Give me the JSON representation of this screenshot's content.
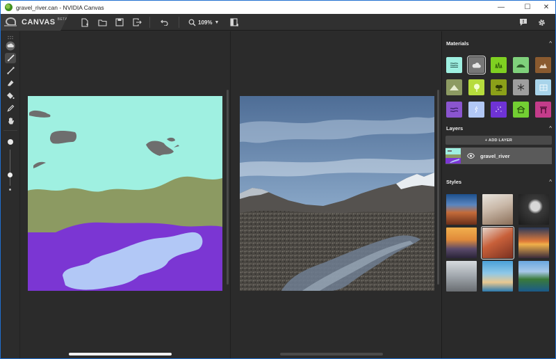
{
  "window": {
    "title": "gravel_river.can - NVIDIA Canvas",
    "minimize": "—",
    "maximize": "☐",
    "close": "✕"
  },
  "toolbar": {
    "brand": "CANVAS",
    "beta": "BETA",
    "zoom": "109%",
    "zoom_caret": "▼"
  },
  "panel": {
    "materials_label": "Materials",
    "layers_label": "Layers",
    "styles_label": "Styles",
    "add_layer_label": "+ ADD LAYER",
    "layer_name": "gravel_river",
    "collapse_glyph": "^"
  },
  "materials": [
    {
      "name": "sky-water-icon",
      "color": "#9ff0e1"
    },
    {
      "name": "cloud-icon",
      "color": "#777777"
    },
    {
      "name": "grass-icon",
      "color": "#7fd021"
    },
    {
      "name": "hill-icon",
      "color": "#7fd07b"
    },
    {
      "name": "rock-icon",
      "color": "#8a5a2f"
    },
    {
      "name": "mountain-icon",
      "color": "#8c9a62"
    },
    {
      "name": "tree-icon",
      "color": "#b6dc3d"
    },
    {
      "name": "bush-icon",
      "color": "#8ba019"
    },
    {
      "name": "snow-icon",
      "color": "#9e9e9e"
    },
    {
      "name": "ice-icon",
      "color": "#a8d4ea"
    },
    {
      "name": "water-icon",
      "color": "#8a55cf"
    },
    {
      "name": "river-icon",
      "color": "#b2c8f6"
    },
    {
      "name": "gravel-icon",
      "color": "#6f33d5"
    },
    {
      "name": "building-icon",
      "color": "#73cf33"
    },
    {
      "name": "shrine-icon",
      "color": "#c43c8a"
    }
  ],
  "colors": {
    "sky": "#9ff0e1",
    "cloud": "#6e6e6e",
    "mountain": "#8c9a62",
    "water": "#7b36d3",
    "river": "#b2c8f6",
    "accent": "#ffffff"
  }
}
